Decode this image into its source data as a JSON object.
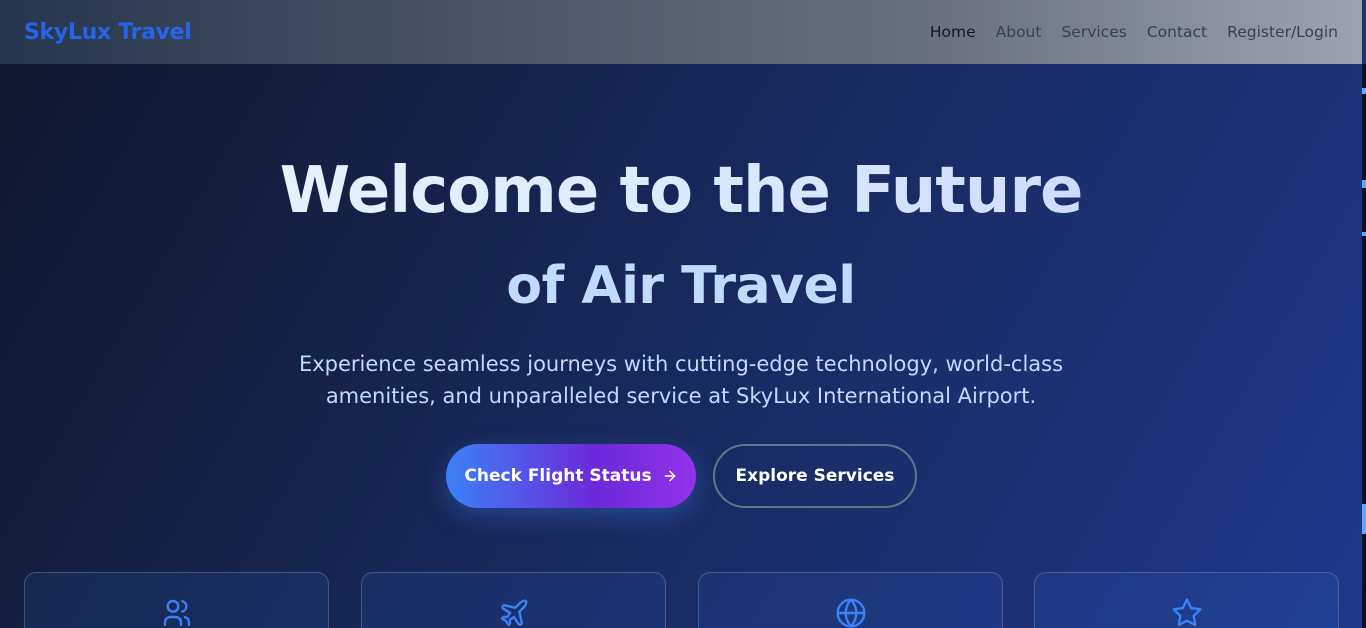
{
  "nav": {
    "brand": "SkyLux Travel",
    "links": [
      {
        "label": "Home"
      },
      {
        "label": "About"
      },
      {
        "label": "Services"
      },
      {
        "label": "Contact"
      },
      {
        "label": "Register/Login"
      }
    ]
  },
  "hero": {
    "title_line1": "Welcome to the Future",
    "title_line2": "of Air Travel",
    "subtitle": "Experience seamless journeys with cutting-edge technology, world-class amenities, and unparalleled service at SkyLux International Airport.",
    "primary_button": "Check Flight Status",
    "secondary_button": "Explore Services"
  },
  "features": [
    {
      "icon": "users-icon"
    },
    {
      "icon": "plane-icon"
    },
    {
      "icon": "globe-icon"
    },
    {
      "icon": "star-icon"
    }
  ],
  "colors": {
    "brand": "#2563eb",
    "icon_accent": "#3b82f6"
  }
}
